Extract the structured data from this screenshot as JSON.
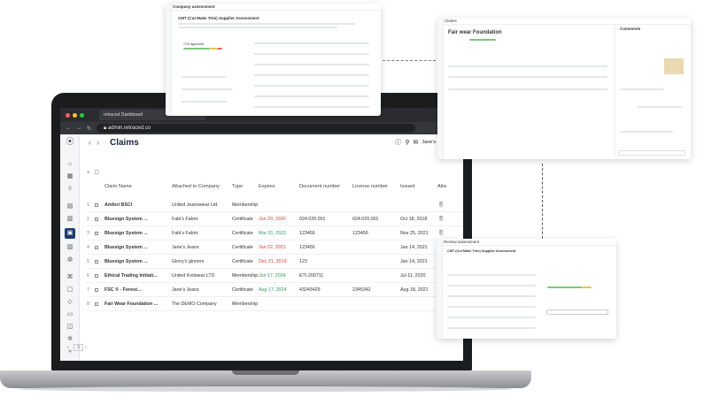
{
  "browser": {
    "tab_title": "retraced Dashboard",
    "url": "admin.retraced.co"
  },
  "header": {
    "title": "Claims",
    "user_name": "Jane's J..."
  },
  "table": {
    "columns": [
      "Claim Name",
      "Attached to Company",
      "Type",
      "Expires",
      "Document number",
      "License number",
      "Issued",
      "Atta"
    ],
    "rows": [
      {
        "idx": "1",
        "claim": "Amfori BSCI",
        "company": "United Jeanswear Ltd.",
        "type": "Membership",
        "expires": "",
        "expires_status": "",
        "doc": "",
        "license": "",
        "issued": ""
      },
      {
        "idx": "2",
        "claim": "Bluesign System ...",
        "company": "Fabi's Fabric",
        "type": "Certificate",
        "expires": "Jun 29, 2020",
        "expires_status": "red",
        "doc": "024.020.001",
        "license": "024.020.001",
        "issued": "Oct 18, 2018"
      },
      {
        "idx": "3",
        "claim": "Bluesign System ...",
        "company": "Fabi's Fabric",
        "type": "Certificate",
        "expires": "Mar 01, 2022",
        "expires_status": "green",
        "doc": "123456",
        "license": "123456",
        "issued": "Nov 25, 2021"
      },
      {
        "idx": "4",
        "claim": "Bluesign System ...",
        "company": "Jane's Jeans",
        "type": "Certificate",
        "expires": "Jan 22, 2021",
        "expires_status": "red",
        "doc": "123456",
        "license": "",
        "issued": "Jan 14, 2021"
      },
      {
        "idx": "5",
        "claim": "Bluesign System ...",
        "company": "Ginny's ginners",
        "type": "Certificate",
        "expires": "Dec 21, 2019",
        "expires_status": "red",
        "doc": "123",
        "license": "",
        "issued": "Jan 14, 2021"
      },
      {
        "idx": "6",
        "claim": "Ethical Trading Initiati...",
        "company": "United Knitwear LTD",
        "type": "Membership",
        "expires": "Jun 17, 2024",
        "expires_status": "green",
        "doc": "ETI-200711",
        "license": "",
        "issued": "Jul 11, 2020"
      },
      {
        "idx": "7",
        "claim": "FSC ® - Forest...",
        "company": "Jane's Jeans",
        "type": "Certificate",
        "expires": "Aug 17, 2024",
        "expires_status": "green",
        "doc": "43243429",
        "license": "2345342",
        "issued": "Aug 18, 2021"
      },
      {
        "idx": "8",
        "claim": "Fair Wear Foundation ...",
        "company": "The DEMO Company",
        "type": "Membership",
        "expires": "",
        "expires_status": "",
        "doc": "",
        "license": "",
        "issued": ""
      }
    ],
    "page": "1"
  },
  "window_company_assessment": {
    "title": "Company assessment",
    "heading": "CMT (Cut Make Trim) Supplier Assessment",
    "progress_label": "71% approved"
  },
  "window_claims_detail": {
    "breadcrumb": "Claims",
    "heading": "Fair wear Foundation",
    "comments_label": "Comments"
  },
  "window_review": {
    "title": "Review assessment",
    "heading": "CMT (Cut Make Trim) Supplier Assessment"
  },
  "colors": {
    "accent": "#1f3b6d",
    "expired": "#d93b3b",
    "valid": "#2e9b52"
  }
}
